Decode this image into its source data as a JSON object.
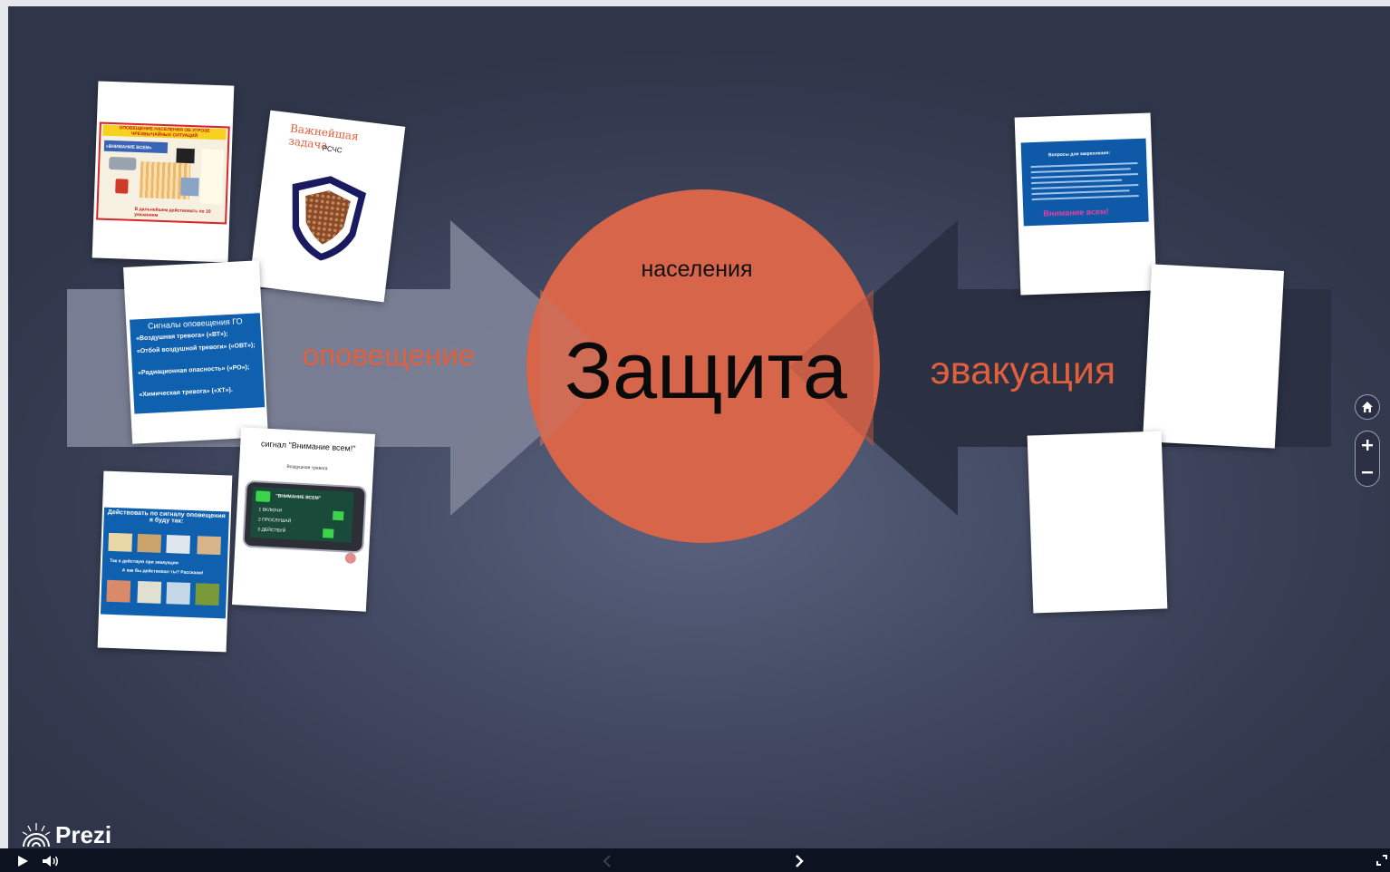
{
  "canvas": {
    "title": "Защита",
    "subtitle": "населения",
    "left_label": "оповещение",
    "right_label": "эвакуация"
  },
  "colors": {
    "accent": "#e0603e",
    "circle": "#d6654a",
    "background": "#3f465d",
    "bar": "#0d1220"
  },
  "cards": {
    "card1": {
      "header": "ОПОВЕЩЕНИЕ НАСЕЛЕНИЯ ОБ УГРОЗЕ ЧРЕЗВЫЧАЙНЫХ СИТУАЦИЙ",
      "badge": "«ВНИМАНИЕ ВСЕМ»",
      "footer": "В дальнейшем действовать по 10 указаниям"
    },
    "card2": {
      "title": "Важнейшая задача",
      "subtitle": "РСЧС"
    },
    "card3": {
      "title": "Сигналы оповещения ГО",
      "items": [
        "«Воздушная тревога» («ВТ»);",
        "«Отбой воздушной тревоги» («ОВТ»);",
        "«Радиационная опасность» («РО»);",
        "«Химическая тревога» («ХТ»)."
      ]
    },
    "card4": {
      "title": "Действовать по сигналу оповещения я буду так:",
      "line1": "Так я действую при эвакуации",
      "line2": "А как бы действовал ты? Расскажи!"
    },
    "card5": {
      "title": "сигнал \"Внимание всем!\"",
      "subtitle": "Воздушная тревога",
      "screen_title": "\"ВНИМАНИЕ ВСЕМ\"",
      "step1": "1 ВКЛЮЧИ",
      "step2": "2 ПРОСЛУШАЙ",
      "step3": "3 ДЕЙСТВУЙ"
    },
    "card6": {
      "title": "Вопросы для закрепления:",
      "banner": "Внимание всем!"
    }
  },
  "logo": {
    "text": "Prezi"
  },
  "controls": {
    "play_icon": "play-icon",
    "volume_icon": "volume-icon",
    "prev_icon": "chevron-left-icon",
    "next_icon": "chevron-right-icon",
    "fullscreen_icon": "fullscreen-icon",
    "home_icon": "home-icon",
    "zoom_in_icon": "plus-icon",
    "zoom_out_icon": "minus-icon"
  }
}
